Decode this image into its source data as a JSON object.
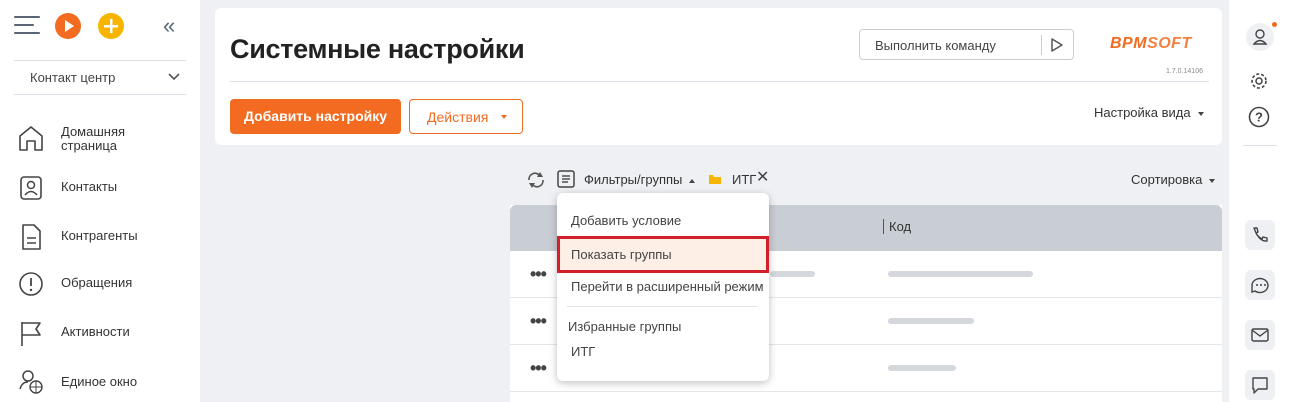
{
  "sidebar": {
    "workspace": "Контакт центр",
    "items": [
      {
        "label_line1": "Домашняя",
        "label_line2": "страница"
      },
      {
        "label": "Контакты"
      },
      {
        "label": "Контрагенты"
      },
      {
        "label": "Обращения"
      },
      {
        "label": "Активности"
      },
      {
        "label": "Единое окно"
      }
    ]
  },
  "header": {
    "title": "Системные настройки",
    "command_placeholder": "Выполнить команду",
    "logo_a": "BPM",
    "logo_b": "SOFT",
    "version": "1.7.0.14106",
    "add_button": "Добавить настройку",
    "actions_button": "Действия",
    "view_settings": "Настройка вида"
  },
  "filterbar": {
    "filters_label": "Фильтры/группы",
    "group_tag": "ИТГ",
    "sort_label": "Сортировка"
  },
  "grid": {
    "column_code": "Код",
    "row_action": "•••"
  },
  "dropdown": {
    "add_condition": "Добавить условие",
    "show_groups": "Показать группы",
    "advanced_mode": "Перейти в расширенный режим",
    "favorites_header": "Избранные группы",
    "favorite_group": "ИТГ"
  },
  "colors": {
    "accent": "#f26b21",
    "highlight_border": "#d2202a"
  }
}
